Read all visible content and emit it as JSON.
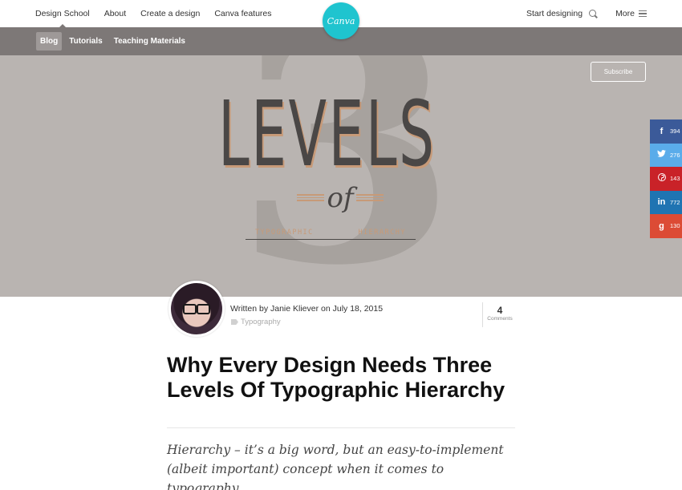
{
  "nav": {
    "items": [
      "Design School",
      "About",
      "Create a design",
      "Canva features"
    ],
    "start_label": "Start designing",
    "more_label": "More",
    "logo_text": "Canva"
  },
  "subnav": {
    "items": [
      "Blog",
      "Tutorials",
      "Teaching Materials"
    ]
  },
  "hero": {
    "big_number": "3",
    "word": "LEVELS",
    "of": "of",
    "subtitle_left": "TYPOGRAPHIC",
    "subtitle_right": "HIERARCHY",
    "subscribe_label": "Subscribe"
  },
  "social": {
    "facebook": "394",
    "twitter": "276",
    "pinterest": "143",
    "linkedin": "772",
    "googleplus": "130"
  },
  "post": {
    "byline": "Written by Janie Kliever on July 18, 2015",
    "tag": "Typography",
    "comment_count": "4",
    "comment_label": "Comments",
    "title": "Why Every Design Needs Three Levels Of Typographic Hierarchy",
    "lead": "Hierarchy – it’s a big word, but an easy-to-implement (albeit important) concept when it comes to typography."
  },
  "colors": {
    "accent": "#1fc4cf",
    "subnav_bg": "#7d7877",
    "hero_bg": "#b9b4b1"
  }
}
